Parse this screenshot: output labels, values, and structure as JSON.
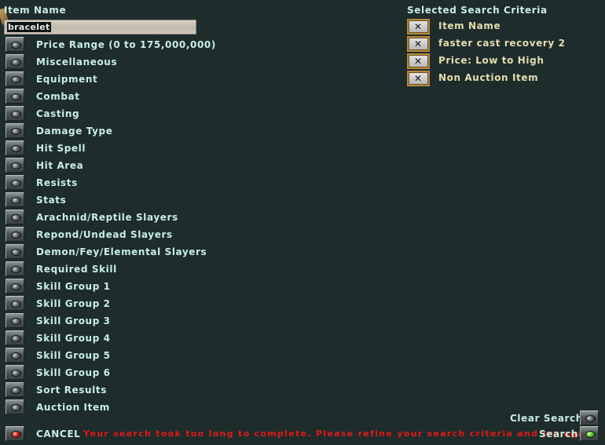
{
  "item_name": {
    "label": "Item Name",
    "value": "bracelet"
  },
  "categories": [
    "Price Range (0 to 175,000,000)",
    "Miscellaneous",
    "Equipment",
    "Combat",
    "Casting",
    "Damage Type",
    "Hit Spell",
    "Hit Area",
    "Resists",
    "Stats",
    "Arachnid/Reptile Slayers",
    "Repond/Undead Slayers",
    "Demon/Fey/Elemental Slayers",
    "Required Skill",
    "Skill Group 1",
    "Skill Group 2",
    "Skill Group 3",
    "Skill Group 4",
    "Skill Group 5",
    "Skill Group 6",
    "Sort Results",
    "Auction Item"
  ],
  "criteria": {
    "title": "Selected Search Criteria",
    "items": [
      "Item Name",
      "faster cast recovery 2",
      "Price: Low to High",
      "Non Auction Item"
    ]
  },
  "footer": {
    "cancel_label": "CANCEL",
    "error_message": "Your search took too long to complete.  Please refine your search criteria and try again.",
    "clear_label": "Clear Search",
    "search_label": "Search"
  },
  "colors": {
    "background": "#1e2c2c",
    "text": "#c8eee4",
    "criteria_text": "#e4ddb0",
    "error": "#e01818"
  }
}
